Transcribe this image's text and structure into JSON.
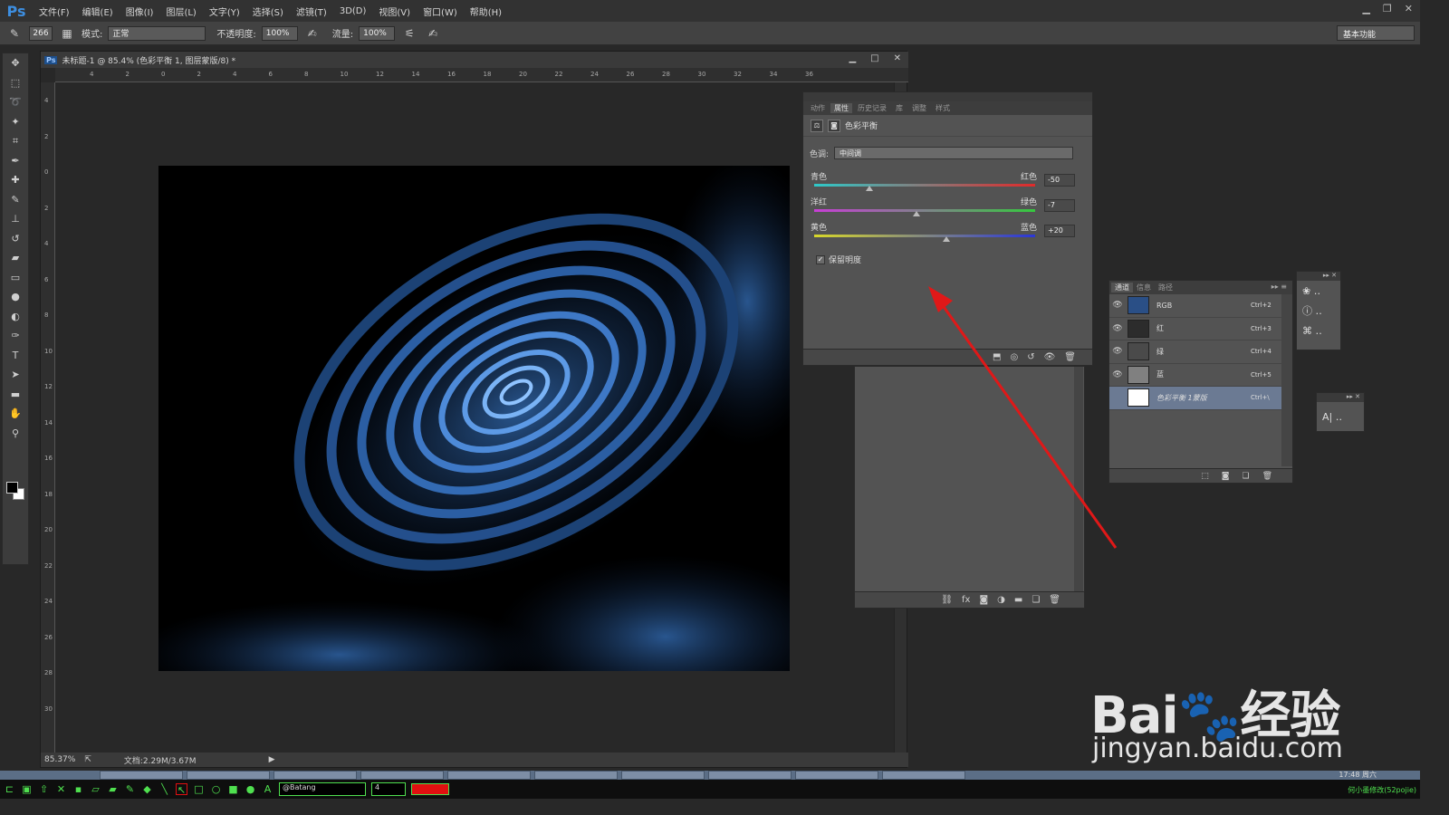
{
  "app": {
    "logo": "Ps",
    "menu": [
      "文件(F)",
      "编辑(E)",
      "图像(I)",
      "图层(L)",
      "文字(Y)",
      "选择(S)",
      "滤镜(T)",
      "3D(D)",
      "视图(V)",
      "窗口(W)",
      "帮助(H)"
    ]
  },
  "options": {
    "brush_size": "266",
    "mode_label": "模式:",
    "mode_value": "正常",
    "opacity_label": "不透明度:",
    "opacity_value": "100%",
    "flow_label": "流量:",
    "flow_value": "100%",
    "workspace": "基本功能"
  },
  "document": {
    "title": "未标题-1 @ 85.4% (色彩平衡 1, 图层蒙版/8) *",
    "zoom": "85.37%",
    "doc_size": "文档:2.29M/3.67M",
    "hruler_labels": [
      "4",
      "2",
      "0",
      "2",
      "4",
      "6",
      "8",
      "10",
      "12",
      "14",
      "16",
      "18",
      "20",
      "22",
      "24",
      "26",
      "28",
      "30",
      "32",
      "34",
      "36"
    ],
    "vruler_labels": [
      "4",
      "2",
      "0",
      "2",
      "4",
      "6",
      "8",
      "10",
      "12",
      "14",
      "16",
      "18",
      "20",
      "22",
      "24",
      "26",
      "28",
      "30"
    ]
  },
  "properties": {
    "tabs": [
      "动作",
      "属性",
      "历史记录",
      "库",
      "调整",
      "样式"
    ],
    "active_tab": 1,
    "title": "色彩平衡",
    "tone_label": "色调:",
    "tone_value": "中间调",
    "sliders": [
      {
        "left": "青色",
        "right": "红色",
        "value": "-50",
        "numeric": -50,
        "gradient": [
          "#2ec9c9",
          "#e02a2a"
        ]
      },
      {
        "left": "洋红",
        "right": "绿色",
        "value": "-7",
        "numeric": -7,
        "gradient": [
          "#c83ed6",
          "#35c93e"
        ]
      },
      {
        "left": "黄色",
        "right": "蓝色",
        "value": "+20",
        "numeric": 20,
        "gradient": [
          "#d8d82a",
          "#2a36d8"
        ]
      }
    ],
    "preserve_label": "保留明度",
    "preserve_checked": "✓"
  },
  "channels": {
    "tabs": [
      "通道",
      "信息",
      "路径"
    ],
    "rows": [
      {
        "name": "RGB",
        "shortcut": "Ctrl+2",
        "eye": "👁",
        "thumb": "#2a4f86"
      },
      {
        "name": "红",
        "shortcut": "Ctrl+3",
        "eye": "👁",
        "thumb": "#333333"
      },
      {
        "name": "绿",
        "shortcut": "Ctrl+4",
        "eye": "👁",
        "thumb": "#555555"
      },
      {
        "name": "蓝",
        "shortcut": "Ctrl+5",
        "eye": "👁",
        "thumb": "#888888"
      },
      {
        "name": "色彩平衡 1蒙版",
        "shortcut": "Ctrl+\\",
        "eye": "",
        "thumb": "#ffffff"
      }
    ]
  },
  "watermark": {
    "logo_text": "Bai🐾经验",
    "url": "jingyan.baidu.com"
  },
  "taskbar": {
    "font": "@Batang",
    "size": "4",
    "clock": "17:48 周六",
    "right_text": "何小墨修改(52pojie)"
  },
  "colors": {
    "accent": "#3d8ee0",
    "arrow": "#e01818",
    "swirl": "#3a78c8"
  }
}
